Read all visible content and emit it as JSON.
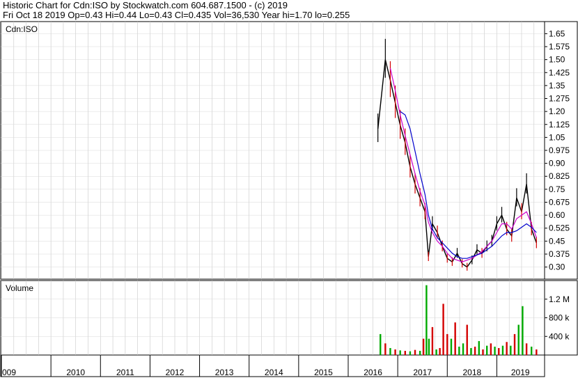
{
  "header": {
    "line1": "Historic Chart for Cdn:ISO by Stockwatch.com 604.687.1500 - (c) 2019",
    "line2": "Fri Oct 18 2019   Op=0.43   Hi=0.44   Lo=0.43   Cl=0.435   Vol=36,530   Year hi=1.70   lo=0.255"
  },
  "chart_data": [
    {
      "type": "line",
      "panel_label": "Cdn:ISO",
      "y_ticks": [
        "1.65",
        "1.575",
        "1.50",
        "1.425",
        "1.35",
        "1.275",
        "1.20",
        "1.125",
        "1.05",
        "0.975",
        "0.90",
        "0.825",
        "0.75",
        "0.675",
        "0.60",
        "0.525",
        "0.45",
        "0.375",
        "0.30"
      ],
      "ylim": [
        0.23,
        1.72
      ],
      "grid": true,
      "colors": {
        "price": "#000000",
        "price_down": "#d40000",
        "ma_short": "#cc00cc",
        "ma_long": "#0000cc"
      },
      "x": [
        2016.6,
        2016.75,
        2016.85,
        2016.95,
        2017.05,
        2017.15,
        2017.25,
        2017.35,
        2017.45,
        2017.55,
        2017.62,
        2017.7,
        2017.8,
        2017.9,
        2018.0,
        2018.1,
        2018.2,
        2018.3,
        2018.4,
        2018.5,
        2018.6,
        2018.7,
        2018.8,
        2018.9,
        2019.0,
        2019.1,
        2019.2,
        2019.3,
        2019.4,
        2019.5,
        2019.6,
        2019.7,
        2019.8
      ],
      "series": [
        {
          "values": [
            1.1,
            1.5,
            1.38,
            1.25,
            1.12,
            1.02,
            0.88,
            0.78,
            0.7,
            0.62,
            0.36,
            0.55,
            0.5,
            0.42,
            0.35,
            0.33,
            0.38,
            0.32,
            0.3,
            0.34,
            0.4,
            0.38,
            0.42,
            0.45,
            0.55,
            0.6,
            0.52,
            0.48,
            0.7,
            0.62,
            0.78,
            0.52,
            0.44
          ]
        },
        {
          "values": [
            null,
            null,
            1.45,
            1.32,
            1.18,
            1.06,
            0.95,
            0.84,
            0.74,
            0.66,
            0.56,
            0.5,
            0.45,
            0.42,
            0.38,
            0.35,
            0.34,
            0.33,
            0.34,
            0.35,
            0.37,
            0.39,
            0.42,
            0.45,
            0.5,
            0.55,
            0.55,
            0.52,
            0.58,
            0.6,
            0.62,
            0.55,
            0.47
          ]
        },
        {
          "values": [
            null,
            null,
            null,
            null,
            1.2,
            1.18,
            1.1,
            0.97,
            0.84,
            0.72,
            0.6,
            0.52,
            0.47,
            0.44,
            0.41,
            0.38,
            0.36,
            0.35,
            0.35,
            0.36,
            0.37,
            0.38,
            0.4,
            0.42,
            0.45,
            0.48,
            0.5,
            0.5,
            0.51,
            0.53,
            0.55,
            0.53,
            0.5
          ]
        }
      ]
    },
    {
      "type": "bar",
      "panel_label": "Volume",
      "y_ticks": [
        "1.2 M",
        "800 k",
        "400 k"
      ],
      "ylim": [
        0,
        1600000
      ],
      "x_ticks": [
        "009",
        "2010",
        "2011",
        "2012",
        "2013",
        "2014",
        "2015",
        "2016",
        "2017",
        "2018",
        "2019"
      ],
      "colors": {
        "up": "#00aa00",
        "down": "#d40000"
      },
      "x": [
        2016.65,
        2016.75,
        2016.85,
        2016.95,
        2017.05,
        2017.15,
        2017.25,
        2017.35,
        2017.45,
        2017.52,
        2017.58,
        2017.63,
        2017.7,
        2017.78,
        2017.85,
        2017.92,
        2018.0,
        2018.08,
        2018.16,
        2018.24,
        2018.32,
        2018.4,
        2018.48,
        2018.56,
        2018.64,
        2018.72,
        2018.8,
        2018.88,
        2018.96,
        2019.04,
        2019.12,
        2019.2,
        2019.28,
        2019.36,
        2019.44,
        2019.52,
        2019.6,
        2019.7,
        2019.8
      ],
      "values": [
        450000,
        250000,
        150000,
        120000,
        100000,
        90000,
        80000,
        110000,
        90000,
        350000,
        1500000,
        350000,
        600000,
        120000,
        150000,
        1100000,
        450000,
        350000,
        700000,
        180000,
        250000,
        650000,
        150000,
        180000,
        300000,
        120000,
        200000,
        250000,
        180000,
        150000,
        200000,
        280000,
        200000,
        450000,
        650000,
        1050000,
        250000,
        180000,
        120000
      ],
      "up": [
        true,
        false,
        true,
        false,
        true,
        false,
        true,
        false,
        true,
        false,
        true,
        true,
        false,
        true,
        false,
        false,
        false,
        true,
        false,
        true,
        true,
        false,
        true,
        false,
        true,
        false,
        true,
        false,
        true,
        false,
        true,
        false,
        true,
        false,
        true,
        true,
        false,
        true,
        false
      ]
    }
  ]
}
